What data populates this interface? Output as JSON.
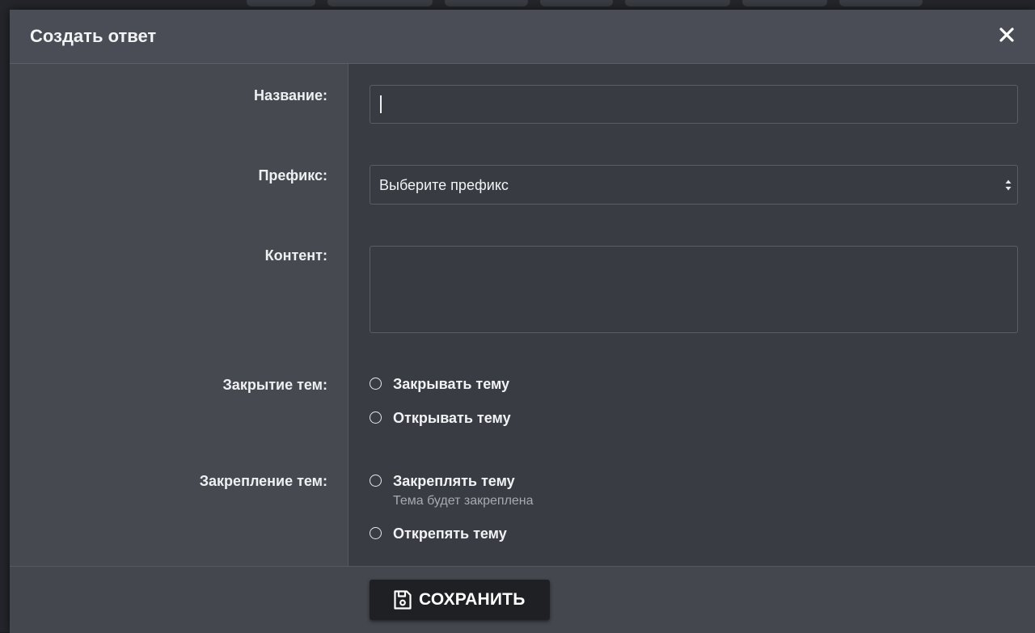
{
  "modal": {
    "title": "Создать ответ",
    "close_icon": "close-icon"
  },
  "form": {
    "name": {
      "label": "Название:",
      "value": ""
    },
    "prefix": {
      "label": "Префикс:",
      "selected": "Выберите префикс"
    },
    "content": {
      "label": "Контент:",
      "value": ""
    },
    "thread_close": {
      "label": "Закрытие тем:",
      "options": [
        "Закрывать тему",
        "Открывать тему"
      ]
    },
    "thread_pin": {
      "label": "Закрепление тем:",
      "options": [
        "Закреплять тему",
        "Открепять тему"
      ],
      "pin_hint": "Тема будет закреплена"
    }
  },
  "footer": {
    "save_label": "СОХРАНИТЬ",
    "save_icon": "floppy-disk-icon"
  },
  "colors": {
    "header_bg": "#4a4d55",
    "label_col_bg": "#464950",
    "field_col_bg": "#393c43",
    "save_button_bg": "#1f2024"
  }
}
